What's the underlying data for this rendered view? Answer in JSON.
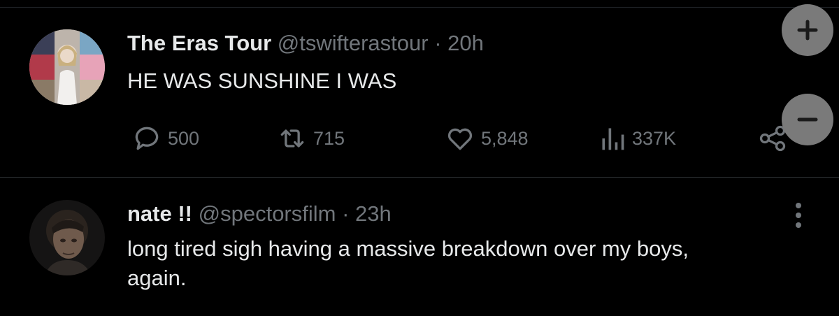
{
  "tweets": [
    {
      "display_name": "The Eras Tour",
      "handle": "@tswifterastour",
      "separator": "·",
      "time": "20h",
      "text": "HE WAS SUNSHINE I WAS",
      "stats": {
        "replies": "500",
        "reposts": "715",
        "likes": "5,848",
        "views": "337K"
      }
    },
    {
      "display_name": "nate !!",
      "handle": "@spectorsfilm",
      "separator": "·",
      "time": "23h",
      "text_line1": "long tired sigh having a massive breakdown over my boys,",
      "text_line2": "again."
    }
  ],
  "icons": {
    "reply": "reply-icon",
    "repost": "repost-icon",
    "like": "heart-icon",
    "views": "views-icon",
    "share": "share-icon",
    "zoom_in": "plus-icon",
    "zoom_out": "minus-icon",
    "more": "more-icon"
  },
  "colors": {
    "background": "#000000",
    "text": "#e7e9ea",
    "muted": "#71767b",
    "divider": "#2f3336",
    "zoom_button": "#7a7a7a"
  }
}
